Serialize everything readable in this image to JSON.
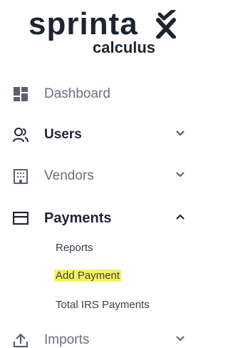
{
  "logo": {
    "main": "sprinta",
    "sub": "calculus"
  },
  "nav": {
    "dashboard": {
      "label": "Dashboard"
    },
    "users": {
      "label": "Users"
    },
    "vendors": {
      "label": "Vendors"
    },
    "payments": {
      "label": "Payments",
      "children": [
        "Reports",
        "Add Payment",
        "Total IRS Payments"
      ]
    },
    "imports": {
      "label": "Imports"
    }
  },
  "colors": {
    "highlight": "#f5f35a",
    "text_dark": "#1f2530",
    "text_muted": "#6a7080"
  }
}
